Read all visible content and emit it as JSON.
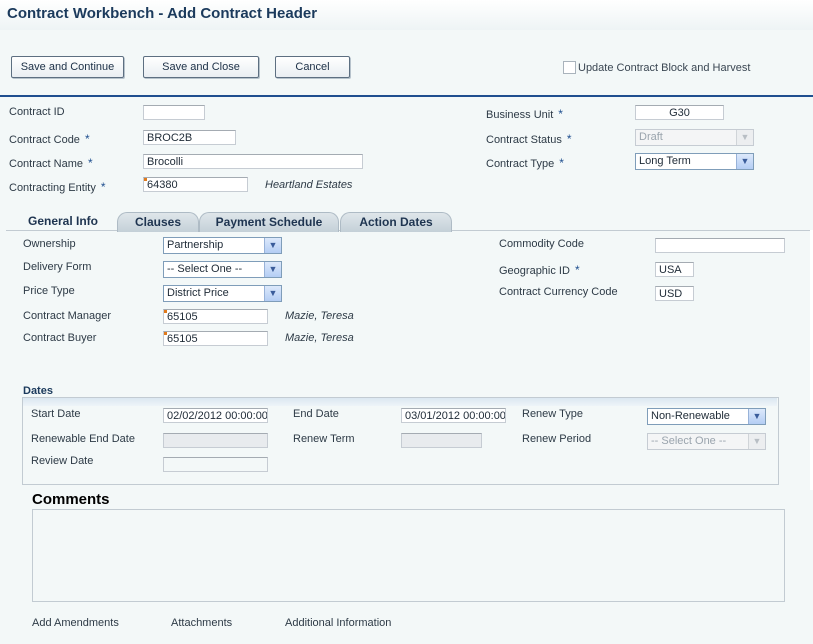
{
  "window": {
    "title": "Contract Workbench - Add Contract Header"
  },
  "toolbar": {
    "save_continue": "Save and Continue",
    "save_close": "Save and Close",
    "cancel": "Cancel",
    "update_block_label": "Update Contract Block and Harvest",
    "update_block_checked": false
  },
  "header": {
    "contract_id": {
      "label": "Contract ID",
      "value": ""
    },
    "contract_code": {
      "label": "Contract Code",
      "value": "BROC2B"
    },
    "contract_name": {
      "label": "Contract Name",
      "value": "Brocolli"
    },
    "contracting_entity": {
      "label": "Contracting Entity",
      "value": "64380",
      "description": "Heartland Estates"
    },
    "business_unit": {
      "label": "Business Unit",
      "value": "G30"
    },
    "contract_status": {
      "label": "Contract Status",
      "value": "Draft"
    },
    "contract_type": {
      "label": "Contract Type",
      "value": "Long Term"
    },
    "required_marker": "*"
  },
  "tabs": [
    {
      "label": "General Info",
      "active": true
    },
    {
      "label": "Clauses",
      "active": false
    },
    {
      "label": "Payment Schedule",
      "active": false
    },
    {
      "label": "Action Dates",
      "active": false
    }
  ],
  "general": {
    "ownership": {
      "label": "Ownership",
      "value": "Partnership"
    },
    "delivery_form": {
      "label": "Delivery Form",
      "value": "-- Select One --"
    },
    "price_type": {
      "label": "Price Type",
      "value": "District Price"
    },
    "contract_manager": {
      "label": "Contract Manager",
      "value": "65105",
      "description": "Mazie, Teresa"
    },
    "contract_buyer": {
      "label": "Contract Buyer",
      "value": "65105",
      "description": "Mazie, Teresa"
    },
    "commodity_code": {
      "label": "Commodity Code",
      "value": ""
    },
    "geographic_id": {
      "label": "Geographic ID",
      "value": "USA"
    },
    "currency_code": {
      "label": "Contract Currency Code",
      "value": "USD"
    }
  },
  "dates": {
    "title": "Dates",
    "start_date": {
      "label": "Start Date",
      "value": "02/02/2012 00:00:00"
    },
    "end_date": {
      "label": "End Date",
      "value": "03/01/2012 00:00:00"
    },
    "renew_type": {
      "label": "Renew Type",
      "value": "Non-Renewable"
    },
    "renewable_end_date": {
      "label": "Renewable End Date",
      "value": ""
    },
    "renew_term": {
      "label": "Renew Term",
      "value": ""
    },
    "renew_period": {
      "label": "Renew Period",
      "value": "-- Select One --"
    },
    "review_date": {
      "label": "Review Date",
      "value": ""
    }
  },
  "comments": {
    "title": "Comments",
    "value": ""
  },
  "footer_links": {
    "amendments": "Add Amendments",
    "attachments": "Attachments",
    "additional_info": "Additional Information"
  }
}
